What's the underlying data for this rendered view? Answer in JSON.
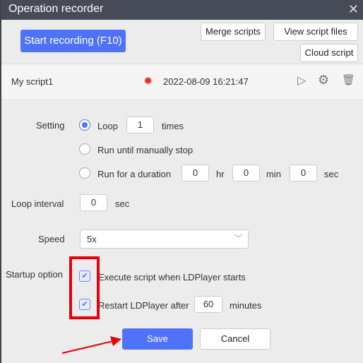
{
  "window": {
    "title": "Operation recorder"
  },
  "toolbar": {
    "start_recording": "Start recording (F10)",
    "merge_scripts": "Merge scripts",
    "view_script_files": "View script files",
    "cloud_script": "Cloud script"
  },
  "script": {
    "name": "My script1",
    "timestamp": "2022-08-09 16:21:47"
  },
  "settings": {
    "setting_label": "Setting",
    "loop_label": "Loop",
    "loop_value": "1",
    "times_label": "times",
    "run_until_stop": "Run until manually stop",
    "run_duration": "Run for a duration",
    "hr_value": "0",
    "hr_label": "hr",
    "min_value": "0",
    "min_label": "min",
    "sec_value": "0",
    "sec_label": "sec",
    "selected_mode": "Loop",
    "loop_interval_label": "Loop interval",
    "loop_interval_value": "0",
    "loop_interval_unit": "sec",
    "speed_label": "Speed",
    "speed_value": "5x",
    "startup_label": "Startup option",
    "execute_on_start": "Execute script when LDPlayer starts",
    "execute_on_start_checked": true,
    "restart_after": "Restart LDPlayer after",
    "restart_value": "60",
    "restart_unit": "minutes",
    "restart_checked": true
  },
  "actions": {
    "save": "Save",
    "cancel": "Cancel"
  },
  "colors": {
    "accent": "#4f73f8",
    "title_bar": "#474b57",
    "highlight": "#e8000b"
  }
}
